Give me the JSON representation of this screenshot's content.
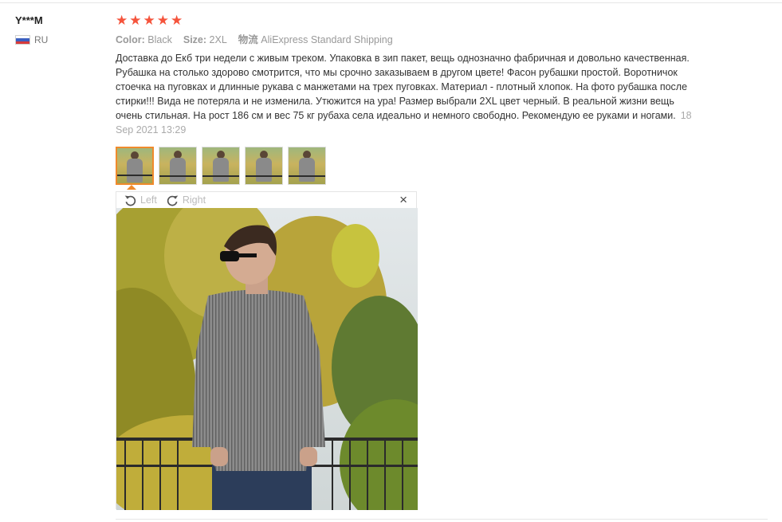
{
  "reviewer": {
    "name": "Y***M",
    "country": "RU"
  },
  "rating": {
    "stars": 5,
    "max": 5
  },
  "sku": {
    "color_label": "Color:",
    "color_value": "Black",
    "size_label": "Size:",
    "size_value": "2XL",
    "shipping_label": "物流",
    "shipping_value": "AliExpress Standard Shipping"
  },
  "review": {
    "text": "Доставка до Екб три недели с живым треком. Упаковка в зип пакет, вещь однозначно фабричная и довольно качественная. Рубашка на столько здорово смотрится, что мы срочно заказываем в другом цвете! Фасон рубашки простой. Воротничок стоечка на пуговках и длинные рукава с манжетами на трех пуговках. Материал - плотный хлопок. На фото рубашка после стирки!!! Вида не потеряла и не изменила. Утюжится на ура! Размер выбрали 2XL цвет черный. В реальной жизни вещь очень стильная. На рост 186 см и вес 75 кг рубаха села идеально и немного свободно. Рекомендую ее руками и ногами.",
    "date": "18 Sep 2021 13:29"
  },
  "thumbnails": {
    "count": 5,
    "active_index": 0
  },
  "viewer": {
    "rotate_left_label": "Left",
    "rotate_right_label": "Right",
    "close_symbol": "×"
  },
  "icons": {
    "star": "star-icon",
    "flag": "flag-ru-icon",
    "rotate_left": "rotate-left-icon",
    "rotate_right": "rotate-right-icon",
    "close": "close-icon"
  },
  "colors": {
    "star": "#f5543c",
    "active_thumb_border": "#f08a2c",
    "meta_text": "#999999"
  }
}
